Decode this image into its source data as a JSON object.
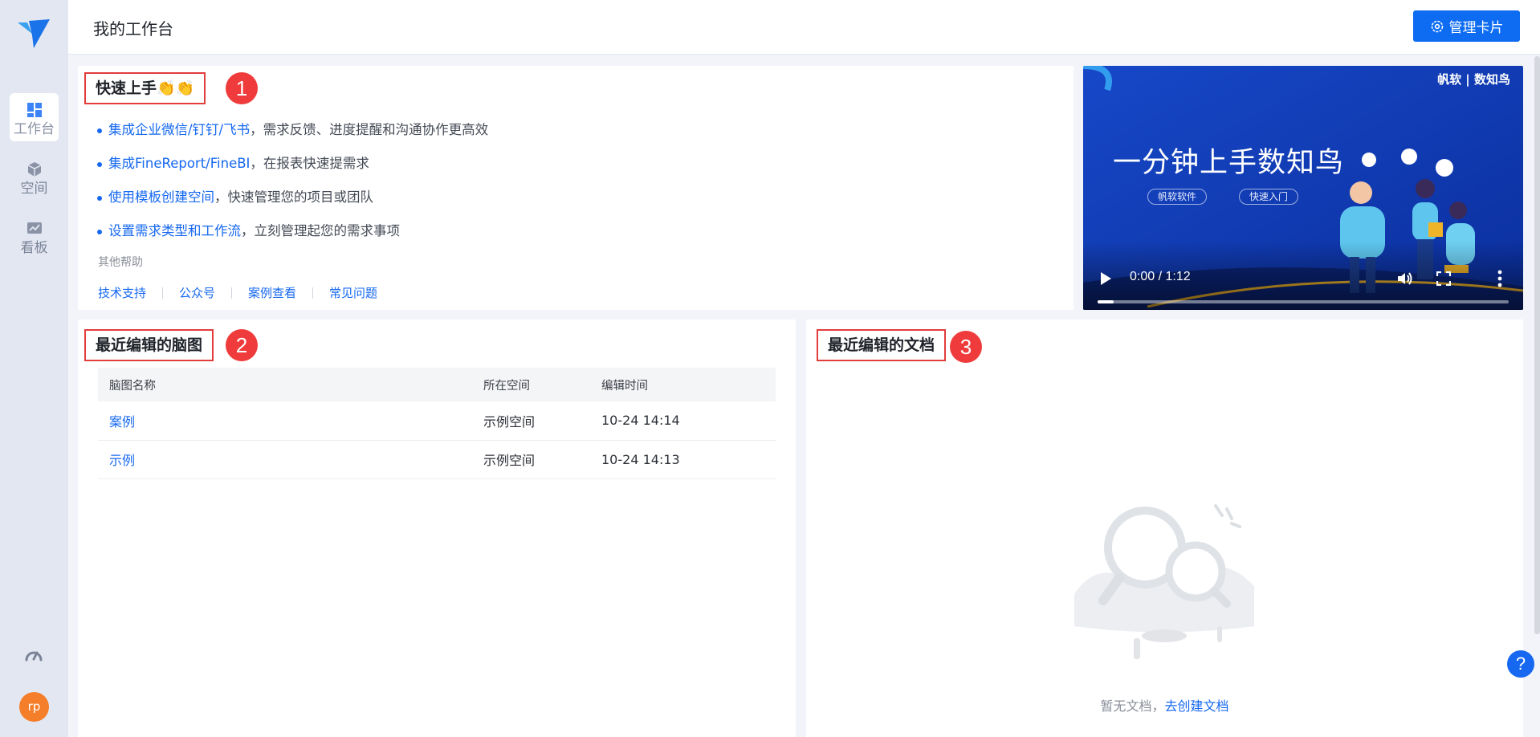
{
  "sidebar": {
    "logo": "product-logo",
    "items": [
      {
        "label": "工作台",
        "icon": "dashboard-grid-icon",
        "active": true
      },
      {
        "label": "空间",
        "icon": "cube-icon",
        "active": false
      },
      {
        "label": "看板",
        "icon": "chart-board-icon",
        "active": false
      }
    ],
    "bottom_icon": "speed-gauge-icon",
    "avatar_text": "rp"
  },
  "header": {
    "title": "我的工作台",
    "manage_button": "管理卡片",
    "manage_icon": "gear-icon"
  },
  "quick_start": {
    "title": "快速上手👏👏",
    "marker": "1",
    "items": [
      {
        "link": "集成企业微信/钉钉/飞书",
        "text": "，需求反馈、进度提醒和沟通协作更高效"
      },
      {
        "link": "集成FineReport/FineBI",
        "text": "，在报表快速提需求"
      },
      {
        "link": "使用模板创建空间",
        "text": "，快速管理您的项目或团队"
      },
      {
        "link": "设置需求类型和工作流",
        "text": "，立刻管理起您的需求事项"
      }
    ],
    "help_title": "其他帮助",
    "help_links": [
      "技术支持",
      "公众号",
      "案例查看",
      "常见问题"
    ]
  },
  "video": {
    "title": "一分钟上手数知鸟",
    "tags": [
      "帆软软件",
      "快速入门"
    ],
    "brand": "帆软 | 数知鸟",
    "time": "0:00 / 1:12",
    "progress": 0.04
  },
  "mindmaps": {
    "title": "最近编辑的脑图",
    "marker": "2",
    "columns": [
      "脑图名称",
      "所在空间",
      "编辑时间"
    ],
    "rows": [
      {
        "name": "案例",
        "space": "示例空间",
        "time": "10-24 14:14"
      },
      {
        "name": "示例",
        "space": "示例空间",
        "time": "10-24 14:13"
      }
    ]
  },
  "documents": {
    "title": "最近编辑的文档",
    "marker": "3",
    "empty_text": "暂无文档，",
    "create_link": "去创建文档"
  },
  "help_fab": "?",
  "colors": {
    "primary": "#1668f0",
    "button": "#0d6cf2",
    "marker": "#ef3b3b",
    "avatar": "#f47e2a"
  }
}
